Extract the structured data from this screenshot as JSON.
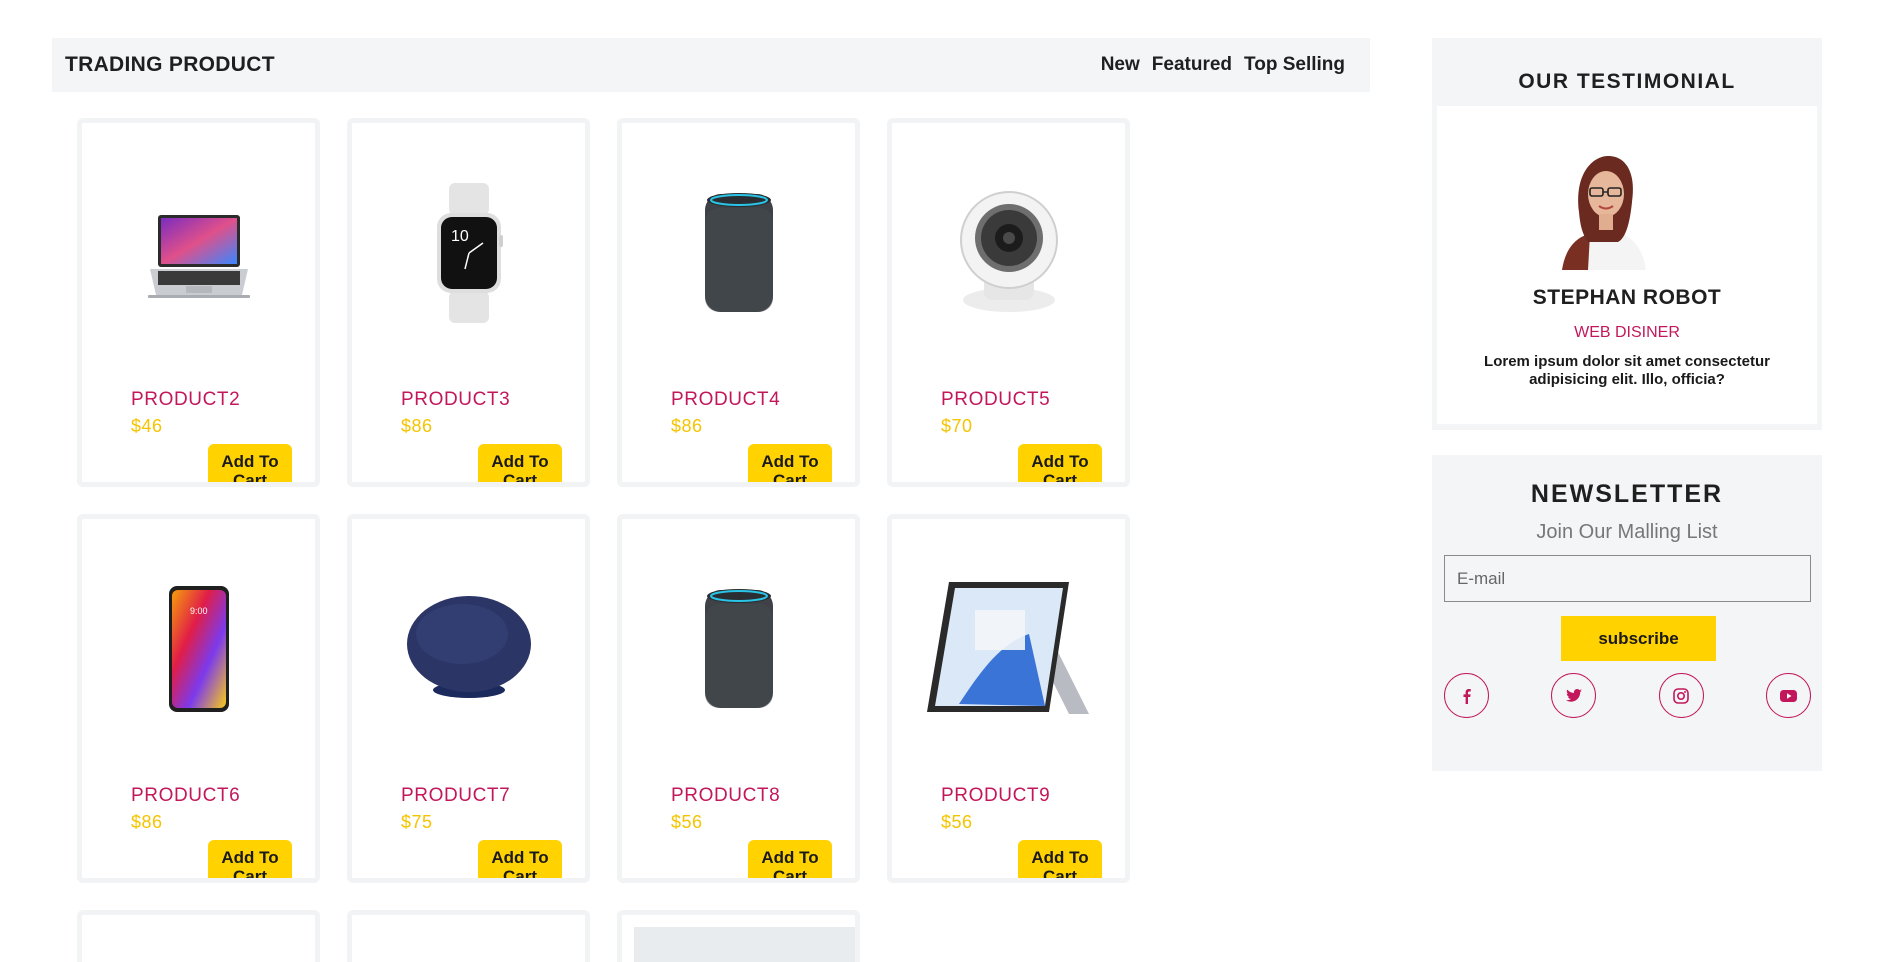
{
  "trading": {
    "title": "TRADING PRODUCT",
    "tabs": [
      "New",
      "Featured",
      "Top Selling"
    ]
  },
  "products": [
    {
      "name": "PRODUCT2",
      "price": "$46",
      "button": "Add To Cart",
      "image": "laptop-image"
    },
    {
      "name": "PRODUCT3",
      "price": "$86",
      "button": "Add To Cart",
      "image": "smartwatch-image"
    },
    {
      "name": "PRODUCT4",
      "price": "$86",
      "button": "Add To Cart",
      "image": "smart-speaker-image"
    },
    {
      "name": "PRODUCT5",
      "price": "$70",
      "button": "Add To Cart",
      "image": "security-camera-image"
    },
    {
      "name": "PRODUCT6",
      "price": "$86",
      "button": "Add To Cart",
      "image": "smartphone-image"
    },
    {
      "name": "PRODUCT7",
      "price": "$75",
      "button": "Add To Cart",
      "image": "wireless-charger-image"
    },
    {
      "name": "PRODUCT8",
      "price": "$56",
      "button": "Add To Cart",
      "image": "smart-speaker-image"
    },
    {
      "name": "PRODUCT9",
      "price": "$56",
      "button": "Add To Cart",
      "image": "tablet-image"
    }
  ],
  "testimonial": {
    "title": "OUR TESTIMONIAL",
    "name": "STEPHAN ROBOT",
    "role": "WEB DISINER",
    "text": "Lorem ipsum dolor sit amet consectetur adipisicing elit. Illo, officia?"
  },
  "newsletter": {
    "title": "NEWSLETTER",
    "subtitle": "Join Our Malling List",
    "email_placeholder": "E-mail",
    "email_value": "",
    "button": "subscribe",
    "socials": [
      "facebook-icon",
      "twitter-icon",
      "instagram-icon",
      "youtube-icon"
    ]
  },
  "colors": {
    "accent_pink": "#c2185b",
    "accent_yellow": "#ffd200",
    "price_yellow": "#f5c400",
    "panel_bg": "#f4f5f7"
  }
}
